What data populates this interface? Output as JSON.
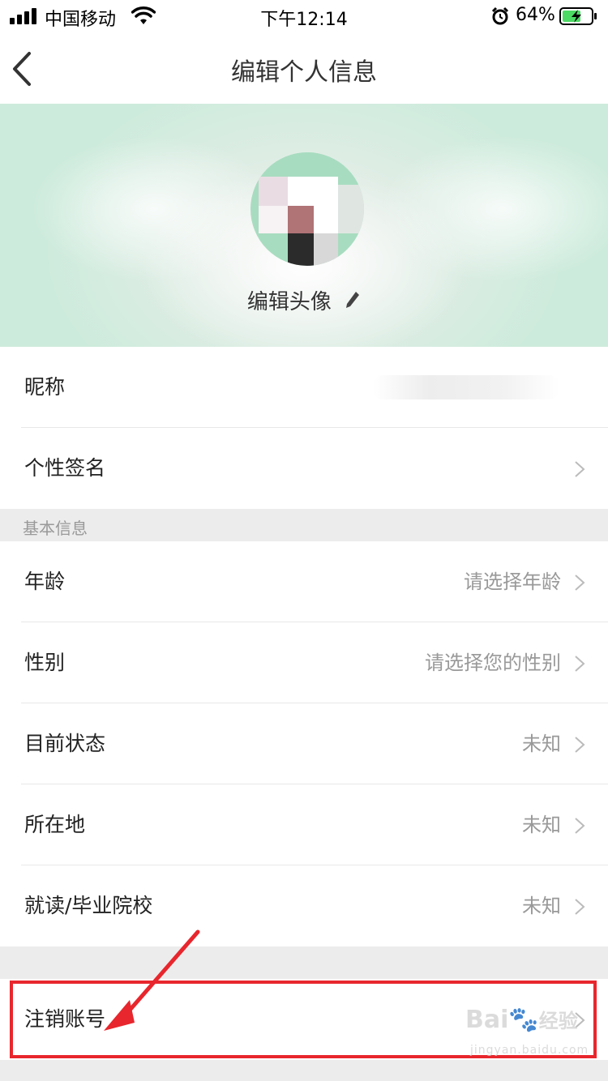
{
  "status_bar": {
    "carrier": "中国移动",
    "time": "下午12:14",
    "battery_percent": "64%",
    "battery_level": 0.64,
    "icons": [
      "signal-icon",
      "wifi-icon",
      "alarm-icon",
      "battery-charging-icon"
    ]
  },
  "nav": {
    "title": "编辑个人信息",
    "back_icon": "chevron-left-icon"
  },
  "avatar_section": {
    "edit_label": "编辑头像",
    "edit_icon": "pencil-icon",
    "colors": {
      "background": "#cdebdc",
      "avatar_bg": "#a8dcc0"
    }
  },
  "profile": {
    "nickname_label": "昵称",
    "signature_label": "个性签名"
  },
  "basic_info": {
    "section_title": "基本信息",
    "items": [
      {
        "label": "年龄",
        "value": "请选择年龄"
      },
      {
        "label": "性别",
        "value": "请选择您的性别"
      },
      {
        "label": "目前状态",
        "value": "未知"
      },
      {
        "label": "所在地",
        "value": "未知"
      },
      {
        "label": "就读/毕业院校",
        "value": "未知"
      }
    ]
  },
  "account": {
    "cancel_account_label": "注销账号"
  },
  "annotation": {
    "color": "#e8262d"
  },
  "watermark": {
    "brand": "Bai",
    "brand_suffix": "经验",
    "domain": "jingyan.baidu.com"
  }
}
